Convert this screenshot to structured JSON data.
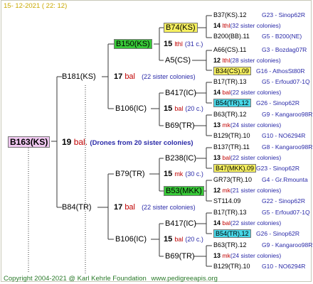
{
  "header": {
    "date": "15- 12-2021 ( 22: 12)"
  },
  "root": {
    "code": "B163(KS)",
    "age": "19",
    "bal": "bal.",
    "note": "(Drones from 20 sister colonies)"
  },
  "gen1": [
    {
      "code": "B181(KS)",
      "age": "17",
      "bal": "bal",
      "note": "(22 sister colonies)"
    },
    {
      "code": "B84(TR)",
      "age": "17",
      "bal": "bal",
      "note": "(22 sister colonies)"
    }
  ],
  "gen2": [
    {
      "code": "B150(KS)",
      "age": "15",
      "bal": "lthl",
      "note": "(31 c.)"
    },
    {
      "code": "B106(IC)",
      "age": "15",
      "bal": "bal",
      "note": "(20 c.)"
    },
    {
      "code": "B79(TR)",
      "age": "15",
      "bal": "mk",
      "note": "(30 c.)"
    },
    {
      "code": "B106(IC)",
      "age": "15",
      "bal": "bal",
      "note": "(20 c.)"
    }
  ],
  "gen3": [
    {
      "code": "B74(KS)"
    },
    {
      "code": "A5(CS)"
    },
    {
      "code": "B417(IC)"
    },
    {
      "code": "B69(TR)"
    },
    {
      "code": "B238(IC)"
    },
    {
      "code": "B53(MKK)"
    },
    {
      "code": "B417(IC)"
    },
    {
      "code": "B69(TR)"
    }
  ],
  "gen4": [
    {
      "a": "B37(KS).12",
      "b": "G23 - Sinop62R",
      "age": "14",
      "bal": "lthl",
      "note": "(32 sister colonies)",
      "c": "B200(BB).11",
      "d": "G5 - B200(NE)"
    },
    {
      "a": "A66(CS).11",
      "b": "G3 - Bozdag07R",
      "age": "12",
      "bal": "lthl",
      "note": "(28 sister colonies)",
      "c": "B34(CS).09",
      "d": "G16 - AthosSt80R"
    },
    {
      "a": "B17(TR).13",
      "b": "G5 - Erfoud07-1Q",
      "age": "14",
      "bal": "bal",
      "note": "(22 sister colonies)",
      "c": "B54(TR).12",
      "d": "G26 - Sinop62R"
    },
    {
      "a": "B63(TR).12",
      "b": "G9 - Kangaroo98R",
      "age": "13",
      "bal": "mk",
      "note": "(24 sister colonies)",
      "c": "B129(TR).10",
      "d": "G10 - NO6294R"
    },
    {
      "a": "B137(TR).11",
      "b": "G8 - Kangaroo98R",
      "age": "13",
      "bal": "bal",
      "note": "(22 sister colonies)",
      "c": "B47(MKK).09",
      "d": "G23 - Sinop62R"
    },
    {
      "a": "GR73(TR).10",
      "b": "G4 - Gr.Rmounta",
      "age": "12",
      "bal": "mk",
      "note": "(21 sister colonies)",
      "c": "ST114.09",
      "d": "G22 - Sinop62R"
    },
    {
      "a": "B17(TR).13",
      "b": "G5 - Erfoud07-1Q",
      "age": "14",
      "bal": "bal",
      "note": "(22 sister colonies)",
      "c": "B54(TR).12",
      "d": "G26 - Sinop62R"
    },
    {
      "a": "B63(TR).12",
      "b": "G9 - Kangaroo98R",
      "age": "13",
      "bal": "mk",
      "note": "(24 sister colonies)",
      "c": "B129(TR).10",
      "d": "G10 - NO6294R"
    }
  ],
  "footer": {
    "copyright": "Copyright 2004-2021 @ Karl Kehrle Foundation",
    "site": "www.pedigreeapis.org"
  },
  "colors": {
    "yellow": "#f6f060",
    "green": "#38c838",
    "cyan": "#48d8e8",
    "pink": "#f0c8f0",
    "red": "#c00000",
    "blue": "#2a2aa8"
  }
}
